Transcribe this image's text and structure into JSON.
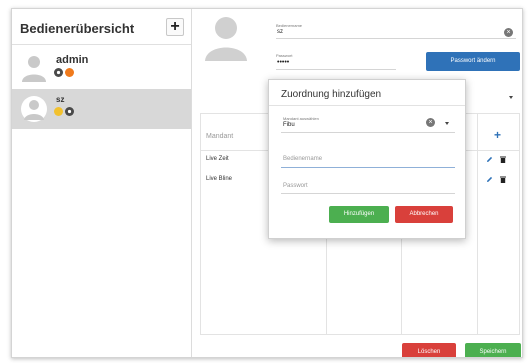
{
  "sidebar": {
    "title": "Bedienerübersicht",
    "add_label": "+",
    "users": [
      {
        "name": "admin"
      },
      {
        "name": "sz"
      }
    ]
  },
  "detail": {
    "username_label": "Bedienername",
    "username_value": "sz",
    "password_label": "Passwort",
    "password_value": "•••••",
    "change_password_label": "Passwort ändern"
  },
  "table": {
    "column_mandant": "Mandant",
    "add_label": "+",
    "rows": [
      {
        "mandant": "Live Zeit"
      },
      {
        "mandant": "Live Bline"
      }
    ]
  },
  "modal": {
    "title": "Zuordnung hinzufügen",
    "select_label": "Mandant auswählen",
    "select_value": "Fibu",
    "username_placeholder": "Bedienername",
    "password_placeholder": "Passwort",
    "add_label": "Hinzufügen",
    "cancel_label": "Abbrechen"
  },
  "footer": {
    "delete_label": "Löschen",
    "save_label": "Speichern"
  },
  "colors": {
    "primary": "#2f72b8",
    "success": "#4caf50",
    "danger": "#d9403b",
    "badge_orange": "#f07a1c",
    "badge_yellow": "#f2c12e",
    "selection": "#d8d8d8"
  }
}
